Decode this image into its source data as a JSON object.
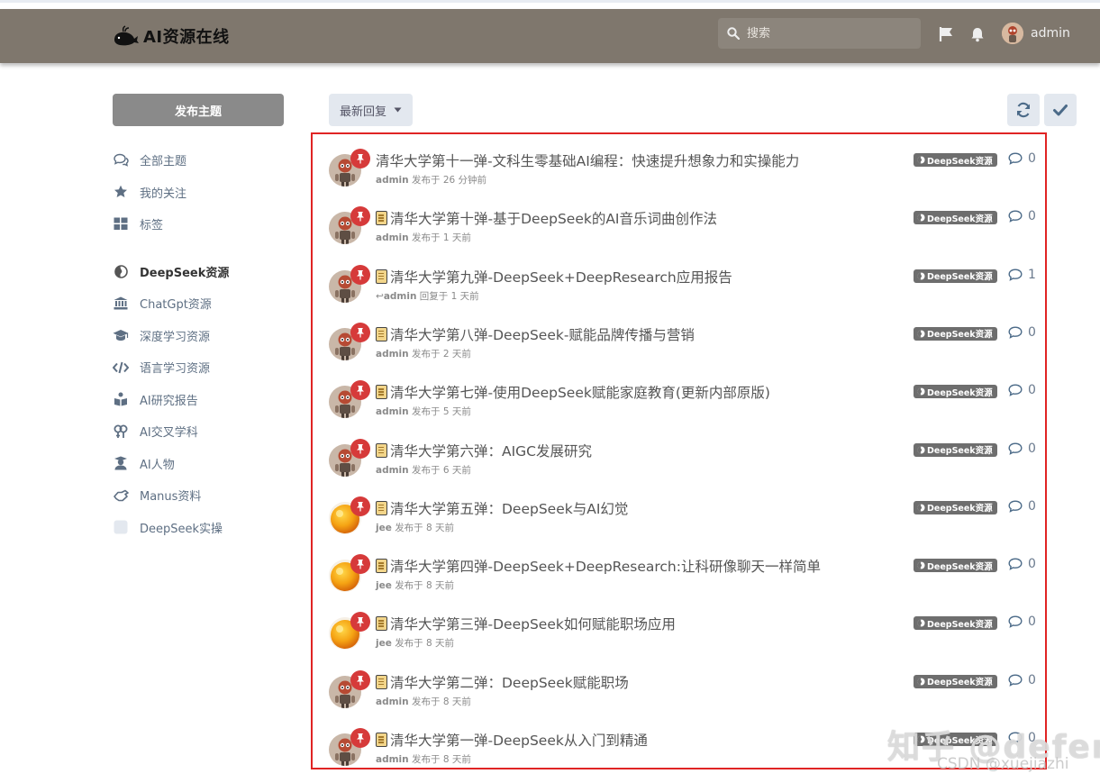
{
  "header": {
    "logo_text": "AI资源在线",
    "search_placeholder": "搜索",
    "username": "admin"
  },
  "sidebar": {
    "new_topic": "发布主题",
    "items": [
      {
        "label": "全部主题",
        "icon": "comments-icon"
      },
      {
        "label": "我的关注",
        "icon": "star-icon"
      },
      {
        "label": "标签",
        "icon": "tags-grid-icon"
      },
      {
        "label": "DeepSeek资源",
        "icon": "deepseek-icon",
        "active": true
      },
      {
        "label": "ChatGpt资源",
        "icon": "bank-icon"
      },
      {
        "label": "深度学习资源",
        "icon": "graduation-cap-icon"
      },
      {
        "label": "语言学习资源",
        "icon": "code-icon"
      },
      {
        "label": "AI研究报告",
        "icon": "reader-icon"
      },
      {
        "label": "AI交叉学科",
        "icon": "venn-icon"
      },
      {
        "label": "AI人物",
        "icon": "user-graduate-icon"
      },
      {
        "label": "Manus资料",
        "icon": "hand-icon"
      },
      {
        "label": "DeepSeek实操",
        "icon": "square-icon"
      }
    ]
  },
  "toolbar": {
    "sort_label": "最新回复"
  },
  "colors": {
    "header_bg": "#7f776d",
    "pin": "#d63a3a",
    "tag_bg": "#6e6e6e",
    "highlight_border": "#e02424"
  },
  "topics": [
    {
      "title": "清华大学第十一弹-文科生零基础AI编程：快速提升想象力和实操能力",
      "doc": false,
      "author": "admin",
      "action": "发布于",
      "time": "26 分钟前",
      "tag": "DeepSeek资源",
      "replies": "0",
      "avatar": "robot"
    },
    {
      "title": "清华大学第十弹-基于DeepSeek的AI音乐词曲创作法",
      "doc": true,
      "author": "admin",
      "action": "发布于",
      "time": "1 天前",
      "tag": "DeepSeek资源",
      "replies": "0",
      "avatar": "robot"
    },
    {
      "title": "清华大学第九弹-DeepSeek+DeepResearch应用报告",
      "doc": true,
      "author": "admin",
      "action": "回复于",
      "time": "1 天前",
      "tag": "DeepSeek资源",
      "replies": "1",
      "avatar": "robot",
      "replied": true
    },
    {
      "title": "清华大学第八弹-DeepSeek-赋能品牌传播与营销",
      "doc": true,
      "author": "admin",
      "action": "发布于",
      "time": "2 天前",
      "tag": "DeepSeek资源",
      "replies": "0",
      "avatar": "robot"
    },
    {
      "title": "清华大学第七弹-使用DeepSeek赋能家庭教育(更新内部原版)",
      "doc": true,
      "author": "admin",
      "action": "发布于",
      "time": "5 天前",
      "tag": "DeepSeek资源",
      "replies": "0",
      "avatar": "robot"
    },
    {
      "title": "清华大学第六弹：AIGC发展研究",
      "doc": true,
      "author": "admin",
      "action": "发布于",
      "time": "6 天前",
      "tag": "DeepSeek资源",
      "replies": "0",
      "avatar": "robot"
    },
    {
      "title": "清华大学第五弹：DeepSeek与AI幻觉",
      "doc": true,
      "author": "jee",
      "action": "发布于",
      "time": "8 天前",
      "tag": "DeepSeek资源",
      "replies": "0",
      "avatar": "orange"
    },
    {
      "title": "清华大学第四弹-DeepSeek+DeepResearch:让科研像聊天一样简单",
      "doc": true,
      "author": "jee",
      "action": "发布于",
      "time": "8 天前",
      "tag": "DeepSeek资源",
      "replies": "0",
      "avatar": "orange"
    },
    {
      "title": "清华大学第三弹-DeepSeek如何赋能职场应用",
      "doc": true,
      "author": "jee",
      "action": "发布于",
      "time": "8 天前",
      "tag": "DeepSeek资源",
      "replies": "0",
      "avatar": "orange"
    },
    {
      "title": "清华大学第二弹：DeepSeek赋能职场",
      "doc": true,
      "author": "admin",
      "action": "发布于",
      "time": "8 天前",
      "tag": "DeepSeek资源",
      "replies": "0",
      "avatar": "robot"
    },
    {
      "title": "清华大学第一弹-DeepSeek从入门到精通",
      "doc": true,
      "author": "admin",
      "action": "发布于",
      "time": "8 天前",
      "tag": "DeepSeek资源",
      "replies": "0",
      "avatar": "robot"
    }
  ],
  "watermark": {
    "line1": "知乎 @defer",
    "line2": "CSDN @xuejiazhi"
  }
}
